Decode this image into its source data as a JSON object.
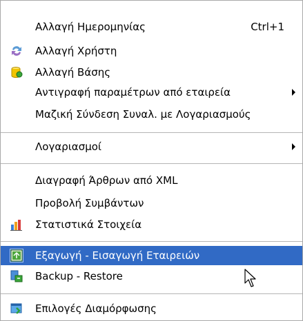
{
  "menu": {
    "items": [
      {
        "label": "Αλλαγή Ημερομηνίας",
        "shortcut": "Ctrl+1"
      },
      {
        "label": "Αλλαγή Χρήστη",
        "icon": "user-switch-icon"
      },
      {
        "label": "Αλλαγή Βάσης",
        "icon": "database-icon"
      },
      {
        "label": "Αντιγραφή παραμέτρων από εταιρεία",
        "submenu": true
      },
      {
        "label": "Μαζική Σύνδεση Συναλ. με Λογαριασμούς"
      },
      {
        "label": "Λογαριασμοί",
        "submenu": true
      },
      {
        "label": "Διαγραφή Άρθρων από XML"
      },
      {
        "label": "Προβολή Συμβάντων"
      },
      {
        "label": "Στατιστικά Στοιχεία",
        "icon": "statistics-icon"
      },
      {
        "label": "Εξαγωγή - Εισαγωγή Εταιρειών",
        "icon": "export-import-icon",
        "selected": true
      },
      {
        "label": "Backup - Restore",
        "icon": "backup-icon"
      },
      {
        "label": "Επιλογές Διαμόρφωσης",
        "icon": "settings-icon"
      }
    ]
  },
  "colors": {
    "highlight": "#316ac5",
    "separator": "#b4b4b4"
  }
}
